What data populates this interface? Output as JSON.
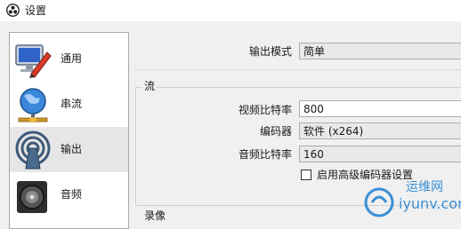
{
  "window": {
    "title": "设置"
  },
  "sidebar": {
    "items": [
      {
        "label": "通用",
        "icon": "monitor-pen-icon"
      },
      {
        "label": "串流",
        "icon": "globe-network-icon"
      },
      {
        "label": "输出",
        "icon": "broadcast-antenna-icon",
        "selected": true
      },
      {
        "label": "音频",
        "icon": "speaker-icon"
      }
    ]
  },
  "output": {
    "mode_label": "输出模式",
    "mode_value": "简单",
    "stream_group_title": "流",
    "video_bitrate_label": "视频比特率",
    "video_bitrate_value": "800",
    "encoder_label": "编码器",
    "encoder_value": "软件 (x264)",
    "audio_bitrate_label": "音频比特率",
    "audio_bitrate_value": "160",
    "advanced_encoder_label": "启用高级编码器设置",
    "advanced_encoder_checked": false,
    "recording_group_title": "录像"
  },
  "watermark": {
    "line1": "运维网",
    "line2": "iyunv.com"
  },
  "colors": {
    "selected_bg": "#e6e6e6",
    "watermark": "#3a8fd6"
  }
}
